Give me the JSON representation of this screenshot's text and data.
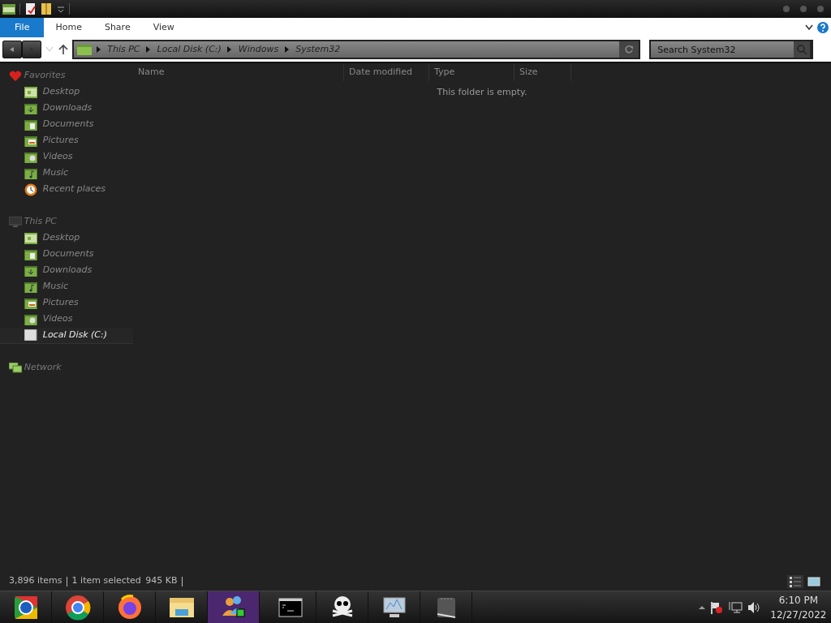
{
  "ribbon_tabs": [
    {
      "label": "File",
      "selected": true
    },
    {
      "label": "Home",
      "selected": false
    },
    {
      "label": "Share",
      "selected": false
    },
    {
      "label": "View",
      "selected": false
    }
  ],
  "address": {
    "crumbs": [
      "This PC",
      "Local Disk (C:)",
      "Windows",
      "System32"
    ]
  },
  "search": {
    "placeholder": "Search System32"
  },
  "sidebar": [
    {
      "label": "Favorites",
      "kind": "favorites",
      "items": [
        {
          "label": "Desktop",
          "kind": "desktop",
          "selected": false
        },
        {
          "label": "Downloads",
          "kind": "downloads",
          "selected": false
        },
        {
          "label": "Documents",
          "kind": "documents",
          "selected": false
        },
        {
          "label": "Pictures",
          "kind": "pictures",
          "selected": false
        },
        {
          "label": "Videos",
          "kind": "videos",
          "selected": false
        },
        {
          "label": "Music",
          "kind": "music",
          "selected": false
        },
        {
          "label": "Recent places",
          "kind": "recent",
          "selected": false
        }
      ]
    },
    {
      "label": "This PC",
      "kind": "pc",
      "items": [
        {
          "label": "Desktop",
          "kind": "desktop",
          "selected": false
        },
        {
          "label": "Documents",
          "kind": "documents",
          "selected": false
        },
        {
          "label": "Downloads",
          "kind": "downloads",
          "selected": false
        },
        {
          "label": "Music",
          "kind": "music",
          "selected": false
        },
        {
          "label": "Pictures",
          "kind": "pictures",
          "selected": false
        },
        {
          "label": "Videos",
          "kind": "videos",
          "selected": false
        },
        {
          "label": "Local Disk (C:)",
          "kind": "drive",
          "selected": true
        }
      ]
    },
    {
      "label": "Network",
      "kind": "network"
    }
  ],
  "columns": [
    "Name",
    "Date modified",
    "Type",
    "Size"
  ],
  "empty_message": "This folder is empty.",
  "status_bar": {
    "item_count": "3,896 items",
    "selection": "1 item selected",
    "size": "945 KB"
  },
  "view_buttons": [
    {
      "kind": "details",
      "selected": true
    },
    {
      "kind": "large-icons",
      "selected": false
    }
  ],
  "clock": {
    "time": "6:10 PM",
    "date": "12/27/2022"
  }
}
